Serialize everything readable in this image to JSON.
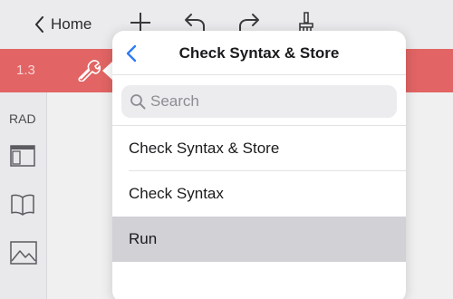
{
  "topbar": {
    "back_label": "Home",
    "icons": [
      "chevron-left-icon",
      "plus-icon",
      "undo-icon",
      "redo-icon",
      "brush-icon"
    ]
  },
  "tabbar": {
    "page_number": "1.3",
    "tool_icon": "wrench-icon",
    "accent_color": "#e26464"
  },
  "sidebar": {
    "angle_mode": "RAD",
    "icons": [
      "layout-icon",
      "book-icon",
      "image-icon"
    ]
  },
  "popover": {
    "title": "Check Syntax & Store",
    "search_placeholder": "Search",
    "items": [
      {
        "label": "Check Syntax & Store",
        "selected": false
      },
      {
        "label": "Check Syntax",
        "selected": false
      },
      {
        "label": "Run",
        "selected": true
      }
    ],
    "link_color": "#2f7bf5"
  }
}
